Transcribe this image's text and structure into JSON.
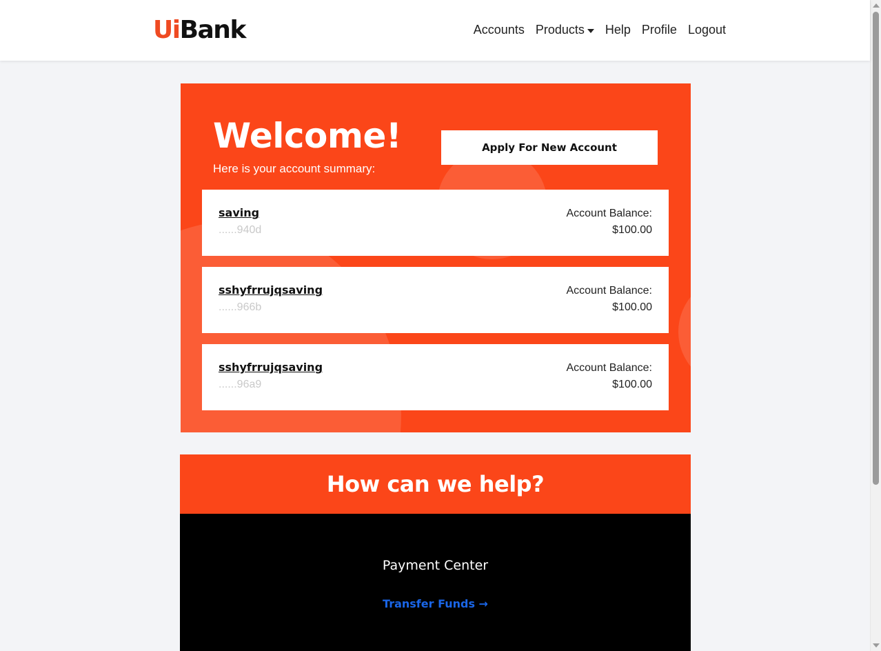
{
  "header": {
    "logo_ui": "Ui",
    "logo_bank": "Bank",
    "nav": {
      "accounts": "Accounts",
      "products": "Products",
      "help": "Help",
      "profile": "Profile",
      "logout": "Logout"
    }
  },
  "welcome": {
    "title": "Welcome!",
    "subtitle": "Here is your account summary:",
    "apply_button": "Apply For New Account",
    "accounts": [
      {
        "name": "saving",
        "id": "......940d",
        "balance_label": "Account Balance:",
        "balance": "$100.00"
      },
      {
        "name": "sshyfrrujqsaving",
        "id": "......966b",
        "balance_label": "Account Balance:",
        "balance": "$100.00"
      },
      {
        "name": "sshyfrrujqsaving",
        "id": "......96a9",
        "balance_label": "Account Balance:",
        "balance": "$100.00"
      }
    ]
  },
  "help": {
    "title": "How can we help?",
    "payment_center": "Payment Center",
    "transfer_link": "Transfer Funds →"
  },
  "colors": {
    "brand_orange": "#fb4619",
    "link_blue": "#1a66e8",
    "dark_section": "#000000"
  }
}
